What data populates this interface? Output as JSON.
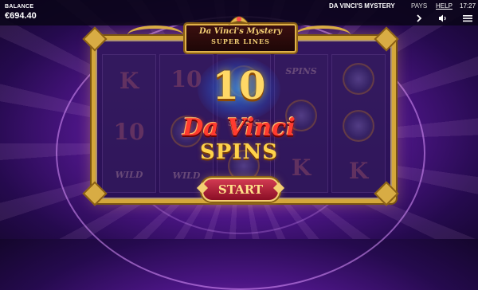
{
  "header": {
    "balance_label": "BALANCE",
    "balance_value": "€694.40",
    "game_title": "DA VINCI'S MYSTERY",
    "pays_label": "PAYS",
    "help_label": "HELP",
    "time": "17:27"
  },
  "controls": {
    "next_icon": "chevron-right-icon",
    "sound_icon": "speaker-icon",
    "menu_icon": "hamburger-menu-icon"
  },
  "banner": {
    "title": "Da Vinci's Mystery",
    "subtitle": "SUPER LINES"
  },
  "reels": [
    [
      "K",
      "10",
      "WILD"
    ],
    [
      "10",
      "GEM",
      "WILD"
    ],
    [
      "GEM",
      "SPINS",
      "GEM"
    ],
    [
      "SPINS",
      "GEM",
      "K"
    ],
    [
      "GEM",
      "GEM",
      "K"
    ]
  ],
  "promo": {
    "count": "10",
    "line1": "Da Vinci",
    "line2": "SPINS",
    "start_label": "START"
  },
  "colors": {
    "gold": "#d4a73a",
    "title_red": "#ff3b2f",
    "title_gold": "#ffd24a",
    "background_purple": "#4a1583"
  }
}
